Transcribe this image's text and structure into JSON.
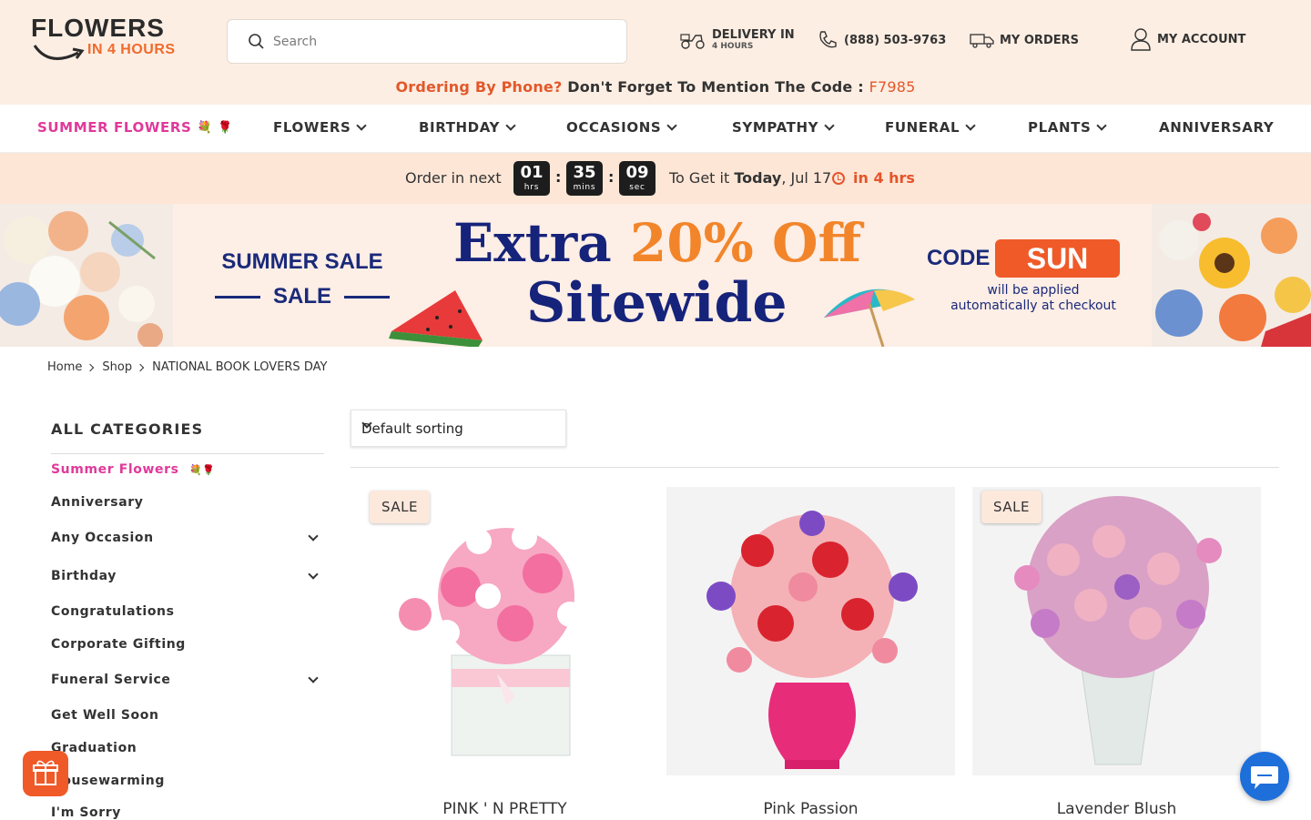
{
  "header": {
    "logo_top": "FLOWERS",
    "logo_bottom": "IN 4 HOURS",
    "search_placeholder": "Search",
    "delivery_label": "DELIVERY IN",
    "delivery_sub": "4 HOURS",
    "phone": "(888) 503-9763",
    "orders": "MY ORDERS",
    "account": "MY ACCOUNT",
    "promo_prefix": "Ordering By Phone?",
    "promo_text": "Don't Forget To Mention The Code :",
    "promo_code": "F7985"
  },
  "nav": {
    "items": [
      {
        "label": "SUMMER FLOWERS"
      },
      {
        "label": "FLOWERS"
      },
      {
        "label": "BIRTHDAY"
      },
      {
        "label": "OCCASIONS"
      },
      {
        "label": "SYMPATHY"
      },
      {
        "label": "FUNERAL"
      },
      {
        "label": "PLANTS"
      },
      {
        "label": "ANNIVERSARY"
      }
    ]
  },
  "countdown": {
    "label": "Order in next",
    "hours": "01",
    "hours_unit": "hrs",
    "mins": "35",
    "mins_unit": "mins",
    "secs": "09",
    "secs_unit": "sec",
    "get_prefix": "To Get it",
    "get_day": "Today",
    "get_date": ", Jul 17",
    "in_hours": "in 4 hrs"
  },
  "banner": {
    "summer_sale_1": "SUMMER SALE",
    "summer_sale_2": "SALE",
    "extra": "Extra",
    "discount": "20% Off",
    "sitewide": "Sitewide",
    "code_label": "CODE",
    "code": "SUN",
    "code_note": "will be applied automatically at checkout"
  },
  "breadcrumb": {
    "home": "Home",
    "shop": "Shop",
    "current": "NATIONAL BOOK LOVERS DAY"
  },
  "sidebar": {
    "title": "ALL CATEGORIES",
    "items": [
      {
        "label": "Summer Flowers"
      },
      {
        "label": "Anniversary"
      },
      {
        "label": "Any Occasion"
      },
      {
        "label": "Birthday"
      },
      {
        "label": "Congratulations"
      },
      {
        "label": "Corporate Gifting"
      },
      {
        "label": "Funeral Service"
      },
      {
        "label": "Get Well Soon"
      },
      {
        "label": "Graduation"
      },
      {
        "label": "Housewarming"
      },
      {
        "label": "I'm Sorry"
      }
    ]
  },
  "sorting": {
    "value": "Default sorting"
  },
  "products": [
    {
      "name": "PINK ' N PRETTY",
      "badge": "SALE"
    },
    {
      "name": "Pink Passion",
      "badge": ""
    },
    {
      "name": "Lavender Blush",
      "badge": "SALE"
    }
  ],
  "colors": {
    "accent": "#ef5a28",
    "navy": "#16237a",
    "pink": "#e0399a",
    "header_bg": "#fdeee3"
  }
}
